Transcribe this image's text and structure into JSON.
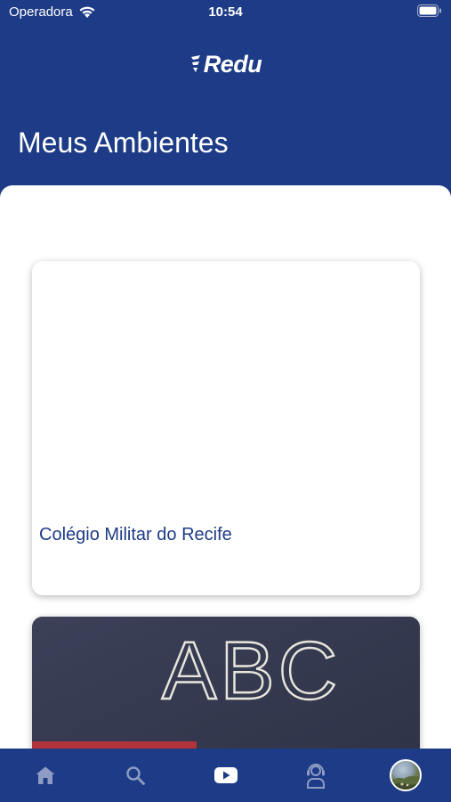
{
  "status_bar": {
    "carrier": "Operadora",
    "time": "10:54"
  },
  "header": {
    "logo_text": "Redu",
    "title": "Meus Ambientes"
  },
  "environments": [
    {
      "name": "Colégio Militar do Recife"
    },
    {
      "image_text": "ABC"
    }
  ],
  "tab_bar": {
    "items": [
      {
        "icon": "home-icon",
        "active": false
      },
      {
        "icon": "search-icon",
        "active": false
      },
      {
        "icon": "play-icon",
        "active": true
      },
      {
        "icon": "support-agent-icon",
        "active": false
      },
      {
        "icon": "avatar",
        "active": false
      }
    ]
  },
  "colors": {
    "brand_blue": "#1d3b86",
    "inactive_icon": "#8e9cc4",
    "active_icon": "#ffffff"
  }
}
